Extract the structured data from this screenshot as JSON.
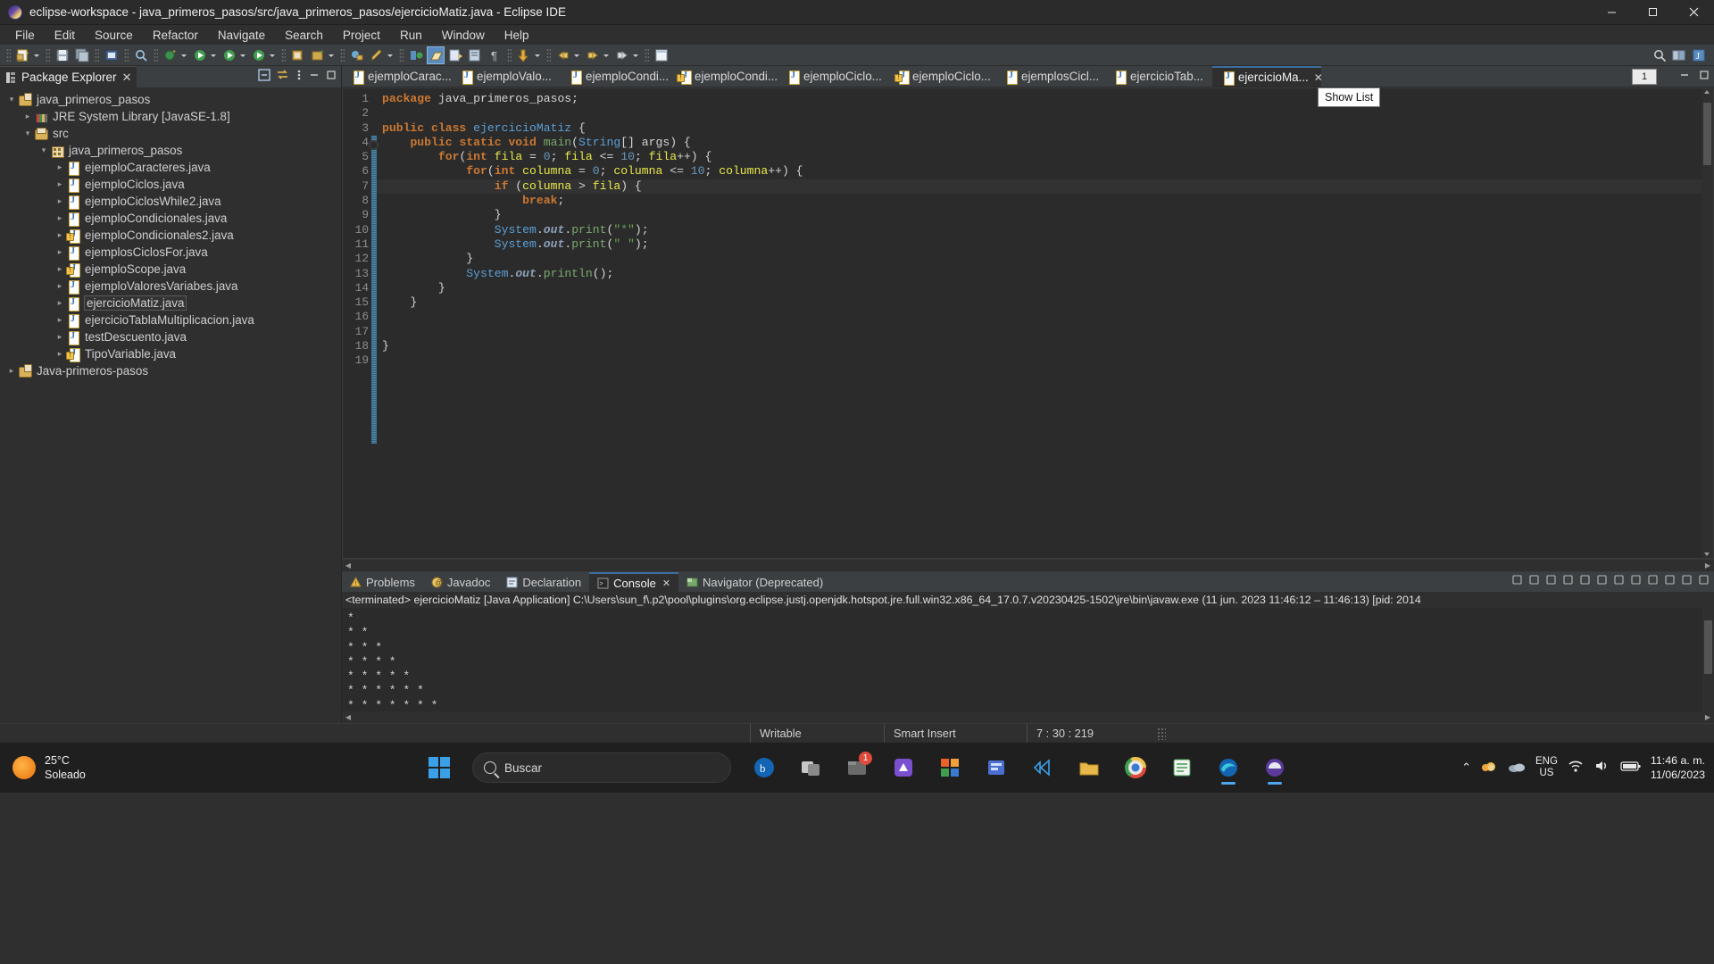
{
  "window": {
    "title": "eclipse-workspace - java_primeros_pasos/src/java_primeros_pasos/ejercicioMatiz.java - Eclipse IDE",
    "minimize": "—",
    "maximize": "❐",
    "close": "✕"
  },
  "menu": [
    "File",
    "Edit",
    "Source",
    "Refactor",
    "Navigate",
    "Search",
    "Project",
    "Run",
    "Window",
    "Help"
  ],
  "package_explorer": {
    "title": "Package Explorer",
    "close_label": "✕",
    "tree": [
      {
        "label": "java_primeros_pasos",
        "indent": 0,
        "chev": "∨",
        "icon": "java-project-icon",
        "selected": false
      },
      {
        "label": "JRE System Library [JavaSE-1.8]",
        "indent": 1,
        "chev": "›",
        "icon": "jre-library-icon",
        "selected": false
      },
      {
        "label": "src",
        "indent": 1,
        "chev": "∨",
        "icon": "source-folder-icon",
        "selected": false
      },
      {
        "label": "java_primeros_pasos",
        "indent": 2,
        "chev": "∨",
        "icon": "package-icon",
        "selected": false
      },
      {
        "label": "ejemploCaracteres.java",
        "indent": 3,
        "chev": "›",
        "icon": "java-file-icon",
        "selected": false
      },
      {
        "label": "ejemploCiclos.java",
        "indent": 3,
        "chev": "›",
        "icon": "java-file-icon",
        "selected": false
      },
      {
        "label": "ejemploCiclosWhile2.java",
        "indent": 3,
        "chev": "›",
        "icon": "java-file-icon",
        "selected": false
      },
      {
        "label": "ejemploCondicionales.java",
        "indent": 3,
        "chev": "›",
        "icon": "java-file-icon",
        "selected": false
      },
      {
        "label": "ejemploCondicionales2.java",
        "indent": 3,
        "chev": "›",
        "icon": "java-file-warning-icon",
        "selected": false
      },
      {
        "label": "ejemplosCiclosFor.java",
        "indent": 3,
        "chev": "›",
        "icon": "java-file-icon",
        "selected": false
      },
      {
        "label": "ejemploScope.java",
        "indent": 3,
        "chev": "›",
        "icon": "java-file-warning-icon",
        "selected": false
      },
      {
        "label": "ejemploValoresVariabes.java",
        "indent": 3,
        "chev": "›",
        "icon": "java-file-icon",
        "selected": false
      },
      {
        "label": "ejercicioMatiz.java",
        "indent": 3,
        "chev": "›",
        "icon": "java-file-icon",
        "selected": true
      },
      {
        "label": "ejercicioTablaMultiplicacion.java",
        "indent": 3,
        "chev": "›",
        "icon": "java-file-icon",
        "selected": false
      },
      {
        "label": "testDescuento.java",
        "indent": 3,
        "chev": "›",
        "icon": "java-file-icon",
        "selected": false
      },
      {
        "label": "TipoVariable.java",
        "indent": 3,
        "chev": "›",
        "icon": "java-file-warning-icon",
        "selected": false
      },
      {
        "label": "Java-primeros-pasos",
        "indent": 0,
        "chev": "›",
        "icon": "java-project-icon",
        "selected": false
      }
    ]
  },
  "editor": {
    "tabs": [
      {
        "label": "ejemploCarac...",
        "active": false,
        "warning": false
      },
      {
        "label": "ejemploValo...",
        "active": false,
        "warning": false
      },
      {
        "label": "ejemploCondi...",
        "active": false,
        "warning": false
      },
      {
        "label": "ejemploCondi...",
        "active": false,
        "warning": true
      },
      {
        "label": "ejemploCiclo...",
        "active": false,
        "warning": false
      },
      {
        "label": "ejemploCiclo...",
        "active": false,
        "warning": true
      },
      {
        "label": "ejemplosCicl...",
        "active": false,
        "warning": false
      },
      {
        "label": "ejercicioTab...",
        "active": false,
        "warning": false
      },
      {
        "label": "ejercicioMa...",
        "active": true,
        "warning": false
      }
    ],
    "close_glyph": "✕",
    "overflow_count": "1",
    "tooltip": "Show List",
    "lines": [
      {
        "n": "1",
        "mark": false,
        "hl": false,
        "tokens": [
          {
            "t": "package ",
            "c": "k"
          },
          {
            "t": "java_primeros_pasos;",
            "c": "plain"
          }
        ]
      },
      {
        "n": "2",
        "mark": false,
        "hl": false,
        "tokens": []
      },
      {
        "n": "3",
        "mark": false,
        "hl": false,
        "tokens": [
          {
            "t": "public class ",
            "c": "k"
          },
          {
            "t": "ejercicioMatiz",
            "c": "cls"
          },
          {
            "t": " {",
            "c": "plain"
          }
        ]
      },
      {
        "n": "4",
        "mark": true,
        "hl": false,
        "tokens": [
          {
            "t": "    ",
            "c": "plain"
          },
          {
            "t": "public static void ",
            "c": "k"
          },
          {
            "t": "main",
            "c": "meth"
          },
          {
            "t": "(",
            "c": "plain"
          },
          {
            "t": "String",
            "c": "cls"
          },
          {
            "t": "[] args) {",
            "c": "plain"
          }
        ]
      },
      {
        "n": "5",
        "mark": false,
        "hl": false,
        "tokens": [
          {
            "t": "        ",
            "c": "plain"
          },
          {
            "t": "for",
            "c": "k"
          },
          {
            "t": "(",
            "c": "plain"
          },
          {
            "t": "int ",
            "c": "k"
          },
          {
            "t": "fila",
            "c": "var"
          },
          {
            "t": " = ",
            "c": "plain"
          },
          {
            "t": "0",
            "c": "num"
          },
          {
            "t": "; ",
            "c": "plain"
          },
          {
            "t": "fila",
            "c": "var"
          },
          {
            "t": " <= ",
            "c": "plain"
          },
          {
            "t": "10",
            "c": "num"
          },
          {
            "t": "; ",
            "c": "plain"
          },
          {
            "t": "fila",
            "c": "var"
          },
          {
            "t": "++) {",
            "c": "plain"
          }
        ]
      },
      {
        "n": "6",
        "mark": false,
        "hl": false,
        "tokens": [
          {
            "t": "            ",
            "c": "plain"
          },
          {
            "t": "for",
            "c": "k"
          },
          {
            "t": "(",
            "c": "plain"
          },
          {
            "t": "int ",
            "c": "k"
          },
          {
            "t": "columna",
            "c": "var"
          },
          {
            "t": " = ",
            "c": "plain"
          },
          {
            "t": "0",
            "c": "num"
          },
          {
            "t": "; ",
            "c": "plain"
          },
          {
            "t": "columna",
            "c": "var"
          },
          {
            "t": " <= ",
            "c": "plain"
          },
          {
            "t": "10",
            "c": "num"
          },
          {
            "t": "; ",
            "c": "plain"
          },
          {
            "t": "columna",
            "c": "var"
          },
          {
            "t": "++) {",
            "c": "plain"
          }
        ]
      },
      {
        "n": "7",
        "mark": false,
        "hl": true,
        "tokens": [
          {
            "t": "                ",
            "c": "plain"
          },
          {
            "t": "if",
            "c": "k"
          },
          {
            "t": " (",
            "c": "plain"
          },
          {
            "t": "columna",
            "c": "var"
          },
          {
            "t": " > ",
            "c": "plain"
          },
          {
            "t": "fila",
            "c": "var"
          },
          {
            "t": ") {",
            "c": "plain"
          }
        ]
      },
      {
        "n": "8",
        "mark": false,
        "hl": false,
        "tokens": [
          {
            "t": "                    ",
            "c": "plain"
          },
          {
            "t": "break",
            "c": "k"
          },
          {
            "t": ";",
            "c": "plain"
          }
        ]
      },
      {
        "n": "9",
        "mark": false,
        "hl": false,
        "tokens": [
          {
            "t": "                }",
            "c": "plain"
          }
        ]
      },
      {
        "n": "10",
        "mark": false,
        "hl": false,
        "tokens": [
          {
            "t": "                ",
            "c": "plain"
          },
          {
            "t": "System",
            "c": "cls"
          },
          {
            "t": ".",
            "c": "plain"
          },
          {
            "t": "out",
            "c": "stat"
          },
          {
            "t": ".",
            "c": "plain"
          },
          {
            "t": "print",
            "c": "meth"
          },
          {
            "t": "(",
            "c": "plain"
          },
          {
            "t": "\"*\"",
            "c": "str"
          },
          {
            "t": ");",
            "c": "plain"
          }
        ]
      },
      {
        "n": "11",
        "mark": false,
        "hl": false,
        "tokens": [
          {
            "t": "                ",
            "c": "plain"
          },
          {
            "t": "System",
            "c": "cls"
          },
          {
            "t": ".",
            "c": "plain"
          },
          {
            "t": "out",
            "c": "stat"
          },
          {
            "t": ".",
            "c": "plain"
          },
          {
            "t": "print",
            "c": "meth"
          },
          {
            "t": "(",
            "c": "plain"
          },
          {
            "t": "\" \"",
            "c": "str"
          },
          {
            "t": ");",
            "c": "plain"
          }
        ]
      },
      {
        "n": "12",
        "mark": false,
        "hl": false,
        "tokens": [
          {
            "t": "            }",
            "c": "plain"
          }
        ]
      },
      {
        "n": "13",
        "mark": false,
        "hl": false,
        "tokens": [
          {
            "t": "            ",
            "c": "plain"
          },
          {
            "t": "System",
            "c": "cls"
          },
          {
            "t": ".",
            "c": "plain"
          },
          {
            "t": "out",
            "c": "stat"
          },
          {
            "t": ".",
            "c": "plain"
          },
          {
            "t": "println",
            "c": "meth"
          },
          {
            "t": "();",
            "c": "plain"
          }
        ]
      },
      {
        "n": "14",
        "mark": false,
        "hl": false,
        "tokens": [
          {
            "t": "        }",
            "c": "plain"
          }
        ]
      },
      {
        "n": "15",
        "mark": false,
        "hl": false,
        "tokens": [
          {
            "t": "    }",
            "c": "plain"
          }
        ]
      },
      {
        "n": "16",
        "mark": false,
        "hl": false,
        "tokens": []
      },
      {
        "n": "17",
        "mark": false,
        "hl": false,
        "tokens": []
      },
      {
        "n": "18",
        "mark": false,
        "hl": false,
        "tokens": [
          {
            "t": "}",
            "c": "plain"
          }
        ]
      },
      {
        "n": "19",
        "mark": false,
        "hl": false,
        "tokens": []
      }
    ]
  },
  "console": {
    "tabs": [
      {
        "label": "Problems",
        "active": false,
        "icon": "problems-icon",
        "closable": false
      },
      {
        "label": "Javadoc",
        "active": false,
        "icon": "javadoc-icon",
        "closable": false
      },
      {
        "label": "Declaration",
        "active": false,
        "icon": "declaration-icon",
        "closable": false
      },
      {
        "label": "Console",
        "active": true,
        "icon": "console-icon",
        "closable": true
      },
      {
        "label": "Navigator (Deprecated)",
        "active": false,
        "icon": "navigator-icon",
        "closable": false
      }
    ],
    "close_glyph": "✕",
    "terminated_line": "<terminated> ejercicioMatiz [Java Application] C:\\Users\\sun_f\\.p2\\pool\\plugins\\org.eclipse.justj.openjdk.hotspot.jre.full.win32.x86_64_17.0.7.v20230425-1502\\jre\\bin\\javaw.exe  (11 jun. 2023 11:46:12 – 11:46:13) [pid: 2014",
    "output": [
      "*",
      "* *",
      "* * *",
      "* * * *",
      "* * * * *",
      "* * * * * *",
      "* * * * * * *",
      "* * * * * * * *"
    ]
  },
  "statusbar": {
    "writable": "Writable",
    "insert_mode": "Smart Insert",
    "position": "7 : 30 : 219"
  },
  "taskbar": {
    "weather_temp": "25°C",
    "weather_desc": "Soleado",
    "search_placeholder": "Buscar",
    "items": [
      {
        "name": "widgets-icon",
        "badge": ""
      },
      {
        "name": "search-icon",
        "badge": ""
      },
      {
        "name": "copilot-icon",
        "badge": ""
      },
      {
        "name": "task-view-icon",
        "badge": ""
      },
      {
        "name": "file-explorer-icon",
        "badge": "1"
      },
      {
        "name": "mail-icon",
        "badge": ""
      },
      {
        "name": "store-icon",
        "badge": ""
      },
      {
        "name": "teams-icon",
        "badge": ""
      },
      {
        "name": "vscode-icon",
        "badge": ""
      },
      {
        "name": "folder-icon",
        "badge": ""
      },
      {
        "name": "chrome-icon",
        "badge": ""
      },
      {
        "name": "notes-icon",
        "badge": ""
      },
      {
        "name": "edge-icon",
        "badge": ""
      },
      {
        "name": "eclipse-icon",
        "badge": ""
      }
    ],
    "lang_top": "ENG",
    "lang_bottom": "US",
    "time": "11:46 a. m.",
    "date": "11/06/2023",
    "chevron": "⌃"
  },
  "colors": {
    "accent": "#3c6e9e",
    "keyword": "#cc7832",
    "string": "#6a9f55",
    "type": "#5c9fd6",
    "number": "#6897bb",
    "variable": "#e8e84a",
    "taskbar_blue": "#3aa0e8"
  }
}
